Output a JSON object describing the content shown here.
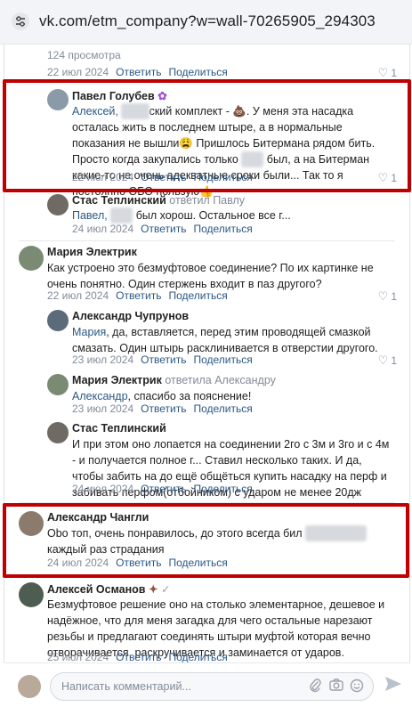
{
  "browser": {
    "url": "vk.com/etm_company?w=wall-70265905_294303"
  },
  "top_partial": {
    "views": "124 просмотра",
    "date": "22 июл 2024",
    "reply": "Ответить",
    "share": "Поделиться",
    "likes": "1"
  },
  "comments": [
    {
      "author": "Павел Голубев",
      "text_parts": [
        "Алексей, ",
        "ский комплект - 💩. У меня эта насадка осталась жить в последнем штыре, а в нормальные показания не вышли😩 Пришлось Битермана рядом бить. Просто когда закупались только ",
        " был, а на Битерман какие-то не очень адекватные сроки были... Так то я постоянно ОБО пользую👍"
      ],
      "date": "22 июл 2024",
      "reply": "Ответить",
      "share": "Поделиться",
      "likes": "1"
    },
    {
      "author": "Стас Теплинский",
      "replied": "ответил Павлу",
      "text_parts": [
        "Павел, ",
        " был хорош. Остальное все г..."
      ],
      "date": "24 июл 2024",
      "reply": "Ответить",
      "share": "Поделиться",
      "likes": ""
    },
    {
      "author": "Мария Электрик",
      "text": "Как устроено это безмуфтовое соединение? По их картинке не очень понятно. Один стержень входит в паз другого?",
      "date": "22 июл 2024",
      "reply": "Ответить",
      "share": "Поделиться",
      "likes": "1"
    },
    {
      "author": "Александр Чупрунов",
      "text_parts": [
        "Мария",
        ", да, вставляется, перед этим проводящей смазкой смазать. Один штырь расклинивается в отверстии другого."
      ],
      "date": "23 июл 2024",
      "reply": "Ответить",
      "share": "Поделиться",
      "likes": "1"
    },
    {
      "author": "Мария Электрик",
      "replied": "ответила Александру",
      "text_parts": [
        "Александр",
        ", спасибо за пояснение!"
      ],
      "date": "23 июл 2024",
      "reply": "Ответить",
      "share": "Поделиться",
      "likes": ""
    },
    {
      "author": "Стас Теплинский",
      "text": "И при этом оно лопается на соединении 2го с 3м и 3го и с 4м - и получается полное г... Ставил несколько таких. И да, чтобы забить на до ещё общёться купить насадку на перф и забивать перфом(отбойником) с ударом не менее 20дж",
      "date": "24 июл 2024",
      "reply": "Ответить",
      "share": "Поделиться",
      "likes": ""
    },
    {
      "author": "Александр Чангли",
      "text_parts": [
        "Obo топ, очень понравилось, до этого всегда бил ",
        " каждый раз страдания"
      ],
      "date": "24 июл 2024",
      "reply": "Ответить",
      "share": "Поделиться",
      "likes": ""
    },
    {
      "author": "Алексей Османов",
      "text": "Безмуфтовое решение оно на столько элементарное, дешевое и надёжное, что для меня загадка для чего остальные нарезают резьбы и предлагают соединять штыри муфтой которая вечно отворачивается, раскручивается и заминается от ударов.",
      "date": "25 июл 2024",
      "reply": "Ответить",
      "share": "Поделиться",
      "likes": ""
    }
  ],
  "composer": {
    "placeholder": "Написать комментарий..."
  },
  "colors": {
    "accent": "#2a5885",
    "muted": "#818c99",
    "highlight": "#c00000"
  }
}
